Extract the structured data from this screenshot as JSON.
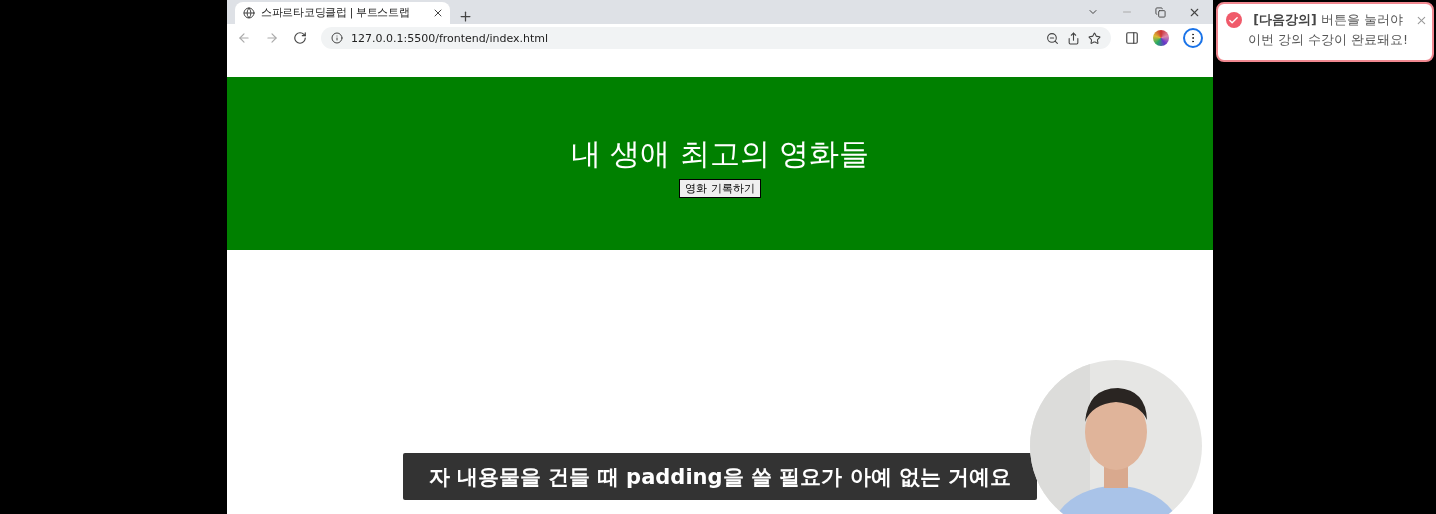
{
  "browser": {
    "tab": {
      "title": "스파르타코딩클럽 | 부트스트랩",
      "selected": true
    },
    "address": "127.0.0.1:5500/frontend/index.html"
  },
  "page": {
    "heading": "내 생애 최고의 영화들",
    "button": "영화 기록하기"
  },
  "toast": {
    "message": "**[다음강의]** 버튼을 눌러야 이번 강의 수강이 완료돼요!"
  },
  "subtitle": "자 내용물을 건들 때 padding을 쓸 필요가 아예 없는 거예요"
}
